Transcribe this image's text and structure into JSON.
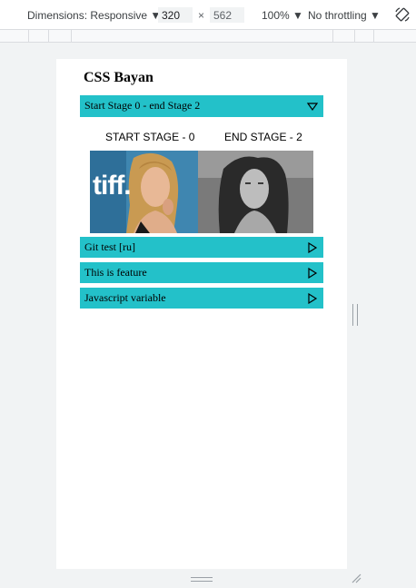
{
  "devtools": {
    "dimensions_label": "Dimensions: Responsive ▼",
    "width_value": "320",
    "height_value": "562",
    "times": "×",
    "zoom_label": "100% ▼",
    "throttle_label": "No throttling ▼",
    "rotate_icon": "rotate-icon"
  },
  "page": {
    "title": "CSS Bayan",
    "accordion": [
      {
        "label": "Start Stage 0 - end Stage 2",
        "expanded": true
      },
      {
        "label": "Git test [ru]",
        "expanded": false
      },
      {
        "label": "This is feature",
        "expanded": false
      },
      {
        "label": "Javascript variable",
        "expanded": false
      }
    ],
    "stage_start": "START STAGE - 0",
    "stage_end": "END STAGE - 2",
    "photo_left_logo": "tiff.",
    "accent_color": "#23c1c9"
  }
}
